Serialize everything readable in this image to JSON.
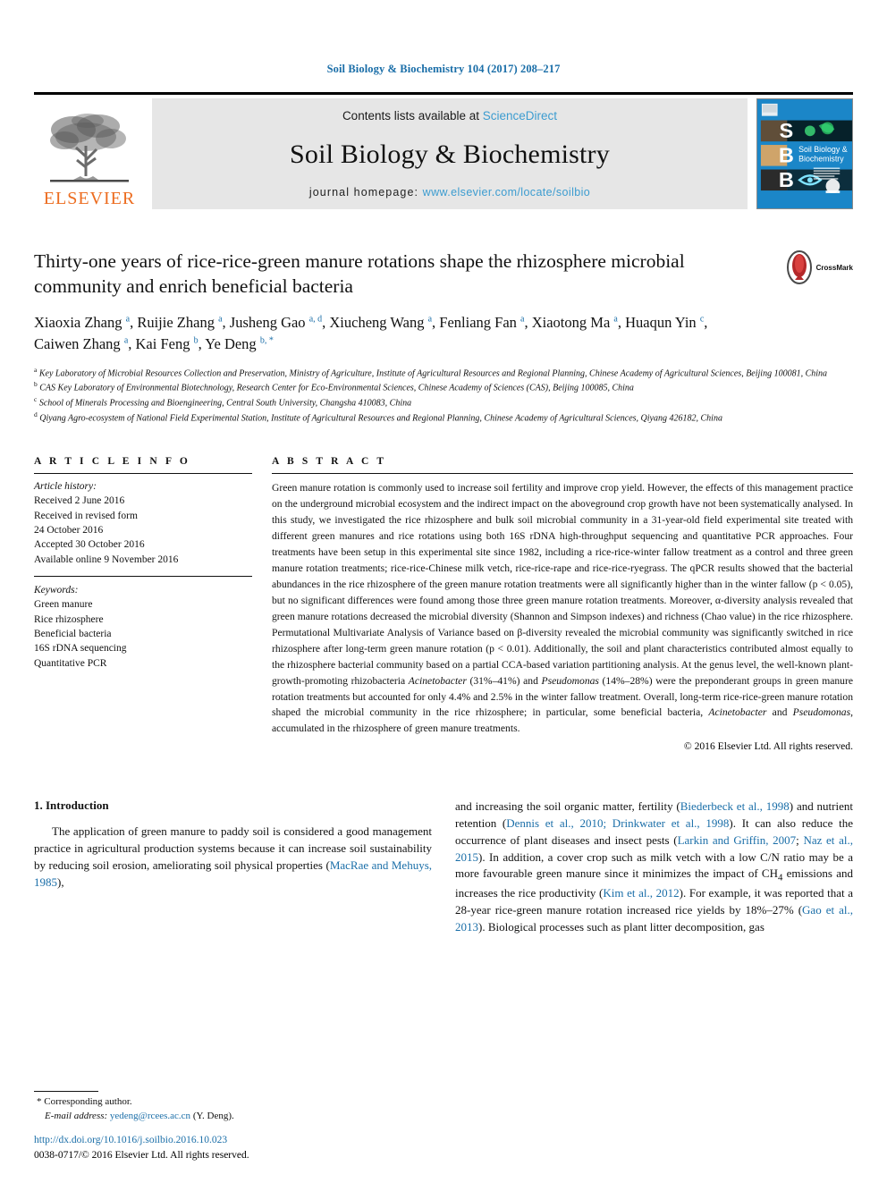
{
  "running_head": "Soil Biology & Biochemistry 104 (2017) 208–217",
  "masthead": {
    "contents_text": "Contents lists available at ",
    "sciencedirect": "ScienceDirect",
    "journal_name": "Soil Biology & Biochemistry",
    "homepage_label": "journal homepage: ",
    "homepage_url": "www.elsevier.com/locate/soilbio",
    "publisher": "ELSEVIER",
    "cover_title_line1": "Soil Biology &",
    "cover_title_line2": "Biochemistry",
    "cover_letters": [
      "S",
      "B",
      "B"
    ],
    "accent_blue": "#3c9cd0",
    "link_blue": "#1a6ea8",
    "elsevier_orange": "#ec6c1f",
    "cover_bg": "#1b86c8"
  },
  "article": {
    "title": "Thirty-one years of rice-rice-green manure rotations shape the rhizosphere microbial community and enrich beneficial bacteria",
    "crossmark_label": "CrossMark",
    "authors_html": "Xiaoxia Zhang <sup>a</sup>, Ruijie Zhang <sup>a</sup>, Jusheng Gao <sup>a, d</sup>, Xiucheng Wang <sup>a</sup>, Fenliang Fan <sup>a</sup>, Xiaotong Ma <sup>a</sup>, Huaqun Yin <sup>c</sup>, Caiwen Zhang <sup>a</sup>, Kai Feng <sup>b</sup>, Ye Deng <sup>b, *</sup>",
    "affiliations": [
      {
        "mark": "a",
        "text": "Key Laboratory of Microbial Resources Collection and Preservation, Ministry of Agriculture, Institute of Agricultural Resources and Regional Planning, Chinese Academy of Agricultural Sciences, Beijing 100081, China"
      },
      {
        "mark": "b",
        "text": "CAS Key Laboratory of Environmental Biotechnology, Research Center for Eco-Environmental Sciences, Chinese Academy of Sciences (CAS), Beijing 100085, China"
      },
      {
        "mark": "c",
        "text": "School of Minerals Processing and Bioengineering, Central South University, Changsha 410083, China"
      },
      {
        "mark": "d",
        "text": "Qiyang Agro-ecosystem of National Field Experimental Station, Institute of Agricultural Resources and Regional Planning, Chinese Academy of Agricultural Sciences, Qiyang 426182, China"
      }
    ]
  },
  "article_info": {
    "heading": "A R T I C L E   I N F O",
    "history_label": "Article history:",
    "history": [
      "Received 2 June 2016",
      "Received in revised form",
      "24 October 2016",
      "Accepted 30 October 2016",
      "Available online 9 November 2016"
    ],
    "keywords_label": "Keywords:",
    "keywords": [
      "Green manure",
      "Rice rhizosphere",
      "Beneficial bacteria",
      "16S rDNA sequencing",
      "Quantitative PCR"
    ]
  },
  "abstract": {
    "heading": "A B S T R A C T",
    "text_html": "Green manure rotation is commonly used to increase soil fertility and improve crop yield. However, the effects of this management practice on the underground microbial ecosystem and the indirect impact on the aboveground crop growth have not been systematically analysed. In this study, we investigated the rice rhizosphere and bulk soil microbial community in a 31-year-old field experimental site treated with different green manures and rice rotations using both 16S rDNA high-throughput sequencing and quantitative PCR approaches. Four treatments have been setup in this experimental site since 1982, including a rice-rice-winter fallow treatment as a control and three green manure rotation treatments; rice-rice-Chinese milk vetch, rice-rice-rape and rice-rice-ryegrass. The qPCR results showed that the bacterial abundances in the rice rhizosphere of the green manure rotation treatments were all significantly higher than in the winter fallow (p &lt; 0.05), but no significant differences were found among those three green manure rotation treatments. Moreover, α-diversity analysis revealed that green manure rotations decreased the microbial diversity (Shannon and Simpson indexes) and richness (Chao value) in the rice rhizosphere. Permutational Multivariate Analysis of Variance based on β-diversity revealed the microbial community was significantly switched in rice rhizosphere after long-term green manure rotation (p &lt; 0.01). Additionally, the soil and plant characteristics contributed almost equally to the rhizosphere bacterial community based on a partial CCA-based variation partitioning analysis. At the genus level, the well-known plant-growth-promoting rhizobacteria <i>Acinetobacter</i> (31%–41%) and <i>Pseudomonas</i> (14%–28%) were the preponderant groups in green manure rotation treatments but accounted for only 4.4% and 2.5% in the winter fallow treatment. Overall, long-term rice-rice-green manure rotation shaped the microbial community in the rice rhizosphere; in particular, some beneficial bacteria, <i>Acinetobacter</i> and <i>Pseudomonas</i>, accumulated in the rhizosphere of green manure treatments.",
    "copyright": "© 2016 Elsevier Ltd. All rights reserved."
  },
  "introduction": {
    "heading": "1. Introduction",
    "left_html": "The application of green manure to paddy soil is considered a good management practice in agricultural production systems because it can increase soil sustainability by reducing soil erosion, ameliorating soil physical properties (<a class=\"ref\" href=\"#\">MacRae and Mehuys, 1985</a>),",
    "right_html": "and increasing the soil organic matter, fertility (<a class=\"ref\" href=\"#\">Biederbeck et al., 1998</a>) and nutrient retention (<a class=\"ref\" href=\"#\">Dennis et al., 2010; Drinkwater et al., 1998</a>). It can also reduce the occurrence of plant diseases and insect pests (<a class=\"ref\" href=\"#\">Larkin and Griffin, 2007</a>; <a class=\"ref\" href=\"#\">Naz et al., 2015</a>). In addition, a cover crop such as milk vetch with a low C/N ratio may be a more favourable green manure since it minimizes the impact of CH<sub>4</sub> emissions and increases the rice productivity (<a class=\"ref\" href=\"#\">Kim et al., 2012</a>). For example, it was reported that a 28-year rice-green manure rotation increased rice yields by 18%–27% (<a class=\"ref\" href=\"#\">Gao et al., 2013</a>). Biological processes such as plant litter decomposition, gas"
  },
  "footnote": {
    "corresponding": "Corresponding author.",
    "email_label": "E-mail address: ",
    "email": "yedeng@rcees.ac.cn",
    "email_suffix": " (Y. Deng).",
    "doi": "http://dx.doi.org/10.1016/j.soilbio.2016.10.023",
    "issn_line": "0038-0717/© 2016 Elsevier Ltd. All rights reserved."
  }
}
